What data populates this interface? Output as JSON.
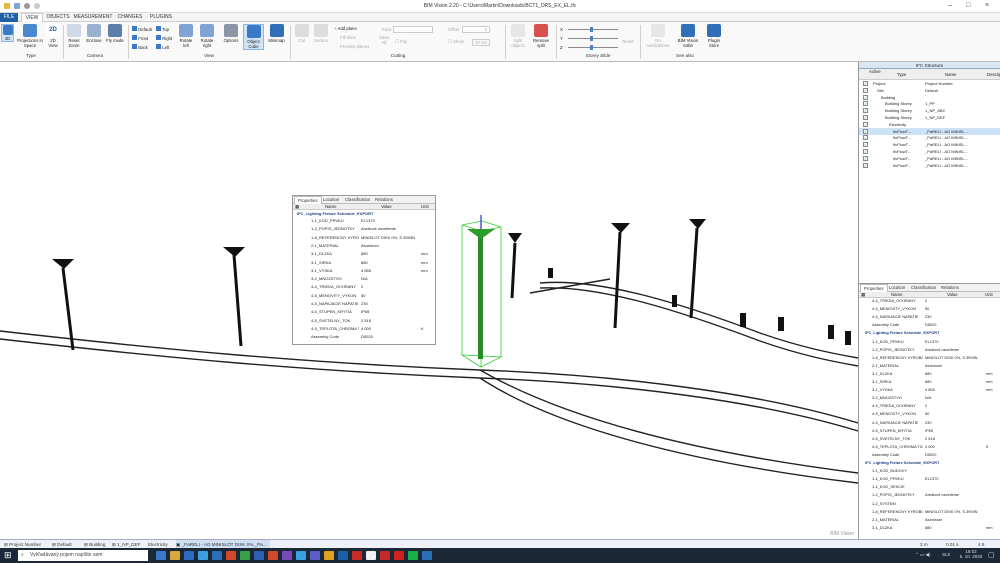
{
  "window": {
    "title": "BIM Vision 2.20 - C:\\Users\\Martin\\Downloads\\BCT1_DRS_EX_EL.ifc"
  },
  "tabs": [
    "FILE",
    "VIEW",
    "OBJECTS",
    "MEASUREMENT",
    "CHANGES",
    "PLUGINS"
  ],
  "ribbon": {
    "type": {
      "b3d": "3D",
      "proj": "Projections in Space",
      "b2d": "2D View",
      "group": "Type"
    },
    "camera": {
      "reset": "Reset Zoom",
      "enclose": "Enclose",
      "fly": "Fly mode",
      "group": "Camera"
    },
    "views": [
      "Default",
      "Front",
      "Back",
      "Top",
      "Right",
      "Left"
    ],
    "view": {
      "rotl": "Rotate left",
      "rotr": "Rotate right",
      "options": "Options",
      "obj": "Object Cube",
      "minimap": "Minimap",
      "group": "View"
    },
    "cutting": {
      "cut": "Cut",
      "section": "Section",
      "addplane": "Add plane",
      "fill": "Fill Slice",
      "preview": "Preview planes",
      "face": "Face",
      "clear": "Clear All",
      "flip": "Flip",
      "offset": "Offset",
      "show": "Show",
      "offset_val": "0",
      "mm": "10 cm",
      "group": "Cutting"
    },
    "split": {
      "split": "Split objects",
      "remove": "Remove split"
    },
    "storey": {
      "x": "X",
      "y": "Y",
      "z": "Z",
      "reset": "Reset",
      "group": "Storey Slide"
    },
    "seealso": {
      "nonot": "No notifications",
      "b64": "BIM Vision 64bit",
      "store": "Plugin Store",
      "group": "See also"
    }
  },
  "float_props": {
    "tabs": [
      "Properties",
      "Location",
      "Classification",
      "Relations"
    ],
    "columns": [
      "Name",
      "Value",
      "Unit"
    ],
    "title": "IFC_Lighting Fixture Schedule_EXPORT",
    "rows": [
      [
        "1-1_KOD_PRVKU",
        "EL1370",
        ""
      ],
      [
        "1-2_POPIS_JEDNOTKY",
        "Areálové osvetlenie",
        ""
      ],
      [
        "1-8_REFERENCNY VYROBOK",
        "MINISLOT DISK 0%, S.3993N",
        ""
      ],
      [
        "2-1_MATERIAL",
        "Aluminum",
        ""
      ],
      [
        "3-1_DLZKA",
        "880",
        "mm"
      ],
      [
        "3-1_SIRKA",
        "880",
        "mm"
      ],
      [
        "3-1_VYSKA",
        "4 855",
        "mm"
      ],
      [
        "3-2_MNOZSTVO",
        "N/A",
        ""
      ],
      [
        "4-4_TRIEDA_OCHRANY",
        "2",
        ""
      ],
      [
        "4-5_MENOVITY_VYKON",
        "50",
        ""
      ],
      [
        "4-5_NAPAJACIE NAPATIE",
        "230",
        ""
      ],
      [
        "4-5_STUPEN_KRYTIA",
        "IP65",
        ""
      ],
      [
        "4-5_SVETELNY_TOK",
        "2 518",
        ""
      ],
      [
        "4-5_TEPLOTA_CHROMA TICKOSTI",
        "4 000",
        "K"
      ],
      [
        "Assembly Code",
        "D5020",
        ""
      ]
    ]
  },
  "structure": {
    "title": "IFC Structure",
    "columns": [
      "Active",
      "Type",
      "Name",
      "Description"
    ],
    "rows": [
      [
        "Project",
        "Project Number"
      ],
      [
        "Site",
        "Default"
      ],
      [
        "Building",
        ""
      ],
      [
        "Building Storey",
        "1_PP"
      ],
      [
        "Building Storey",
        "1_NP_ABC"
      ],
      [
        "Building Storey",
        "1_NP_DEF"
      ],
      [
        "Electricity",
        ""
      ],
      [
        "IfcFlowT...",
        "_PaRELI - AO MINISL..."
      ],
      [
        "IfcFlowT...",
        "_PaRELI - AO MINISL..."
      ],
      [
        "IfcFlowT...",
        "_PaRELI - AO MINISL..."
      ],
      [
        "IfcFlowT...",
        "_PaRELI - AO MINISL..."
      ],
      [
        "IfcFlowT...",
        "_PaRELI - AO MINISL..."
      ],
      [
        "IfcFlowT...",
        "_PaRELI - AO MINISL..."
      ]
    ]
  },
  "right_props": {
    "tabs": [
      "Properties",
      "Location",
      "Classification",
      "Relations"
    ],
    "columns": [
      "Name",
      "Value",
      "Unit"
    ],
    "rows": [
      [
        "4-4_TRIEDA_OCHRANY",
        "2",
        "",
        0
      ],
      [
        "4-5_MENOVITY_VYKON",
        "50",
        "",
        0
      ],
      [
        "4-5_NAPAJACIE NAPATIE",
        "230",
        "",
        0
      ],
      [
        "Assembly Code",
        "D5020",
        "",
        0
      ],
      [
        "IFC_Lighting Fixture Schedule_EXPORT",
        "",
        "",
        1
      ],
      [
        "1-1_KOD_PRVKU",
        "EL1370",
        "",
        0
      ],
      [
        "1-2_POPIS_JEDNOTKY",
        "Areálové osvetlenie",
        "",
        0
      ],
      [
        "1-8_REFERENCNY VYROBOK",
        "MINISLOT DISK 0%, S.3993N",
        "",
        0
      ],
      [
        "2-1_MATERIAL",
        "Aluminum",
        "",
        0
      ],
      [
        "3-1_DLZKA",
        "880",
        "mm",
        0
      ],
      [
        "3-1_SIRKA",
        "880",
        "mm",
        0
      ],
      [
        "3-1_VYSKA",
        "4 855",
        "mm",
        0
      ],
      [
        "3-2_MNOZSTVO",
        "N/A",
        "",
        0
      ],
      [
        "4-4_TRIEDA_OCHRANY",
        "2",
        "",
        0
      ],
      [
        "4-5_MENOVITY_VYKON",
        "50",
        "",
        0
      ],
      [
        "4-5_NAPAJACIE NAPATIE",
        "230",
        "",
        0
      ],
      [
        "4-5_STUPEN_KRYTIA",
        "IP65",
        "",
        0
      ],
      [
        "4-5_SVETELNY_TOK",
        "2 518",
        "",
        0
      ],
      [
        "4-5_TEPLOTA_CHROMA TICKOSTI",
        "4 000",
        "K",
        0
      ],
      [
        "Assembly Code",
        "D5020",
        "",
        0
      ],
      [
        "IFC_Lighting Fixture Schedule_EXPORT",
        "",
        "",
        1
      ],
      [
        "1-1_KOD_BUDOVY",
        "",
        "",
        0
      ],
      [
        "1-1_KOD_PRVKU",
        "EL1370",
        "",
        0
      ],
      [
        "1-1_KOD_SEKCIE",
        "",
        "",
        0
      ],
      [
        "1-2_POPIS_JEDNOTKY",
        "Areálové osvetlenie",
        "",
        0
      ],
      [
        "1-2_SYSTEM",
        "",
        "",
        0
      ],
      [
        "1-8_REFERENCNY VYROBOK",
        "MINISLOT DISK 0%, S.3993N",
        "",
        0
      ],
      [
        "2-1_MATERIAL",
        "Aluminum",
        "",
        0
      ],
      [
        "3-1_DLZKA",
        "880",
        "mm",
        0
      ]
    ]
  },
  "status": {
    "items": [
      "Project Number",
      "Default",
      "Building",
      "1_NP_DEF",
      "Electricity",
      "_PaRELI - AO MINISLOT DISK 0%,_Pa..."
    ],
    "fps": "3 m",
    "time": "0.01 s",
    "val": "4.8"
  },
  "viewport": {
    "watermark": "BIM Vision"
  },
  "taskbar": {
    "search": "Vyhľadávaný pojem napíšte sem",
    "time": "16:02",
    "date": "5. 10. 2020",
    "lang": "SLK"
  },
  "colors": {
    "accent": "#1f5fa8",
    "selected_object": "#2a9d2a",
    "bbox": "#33cc33"
  }
}
